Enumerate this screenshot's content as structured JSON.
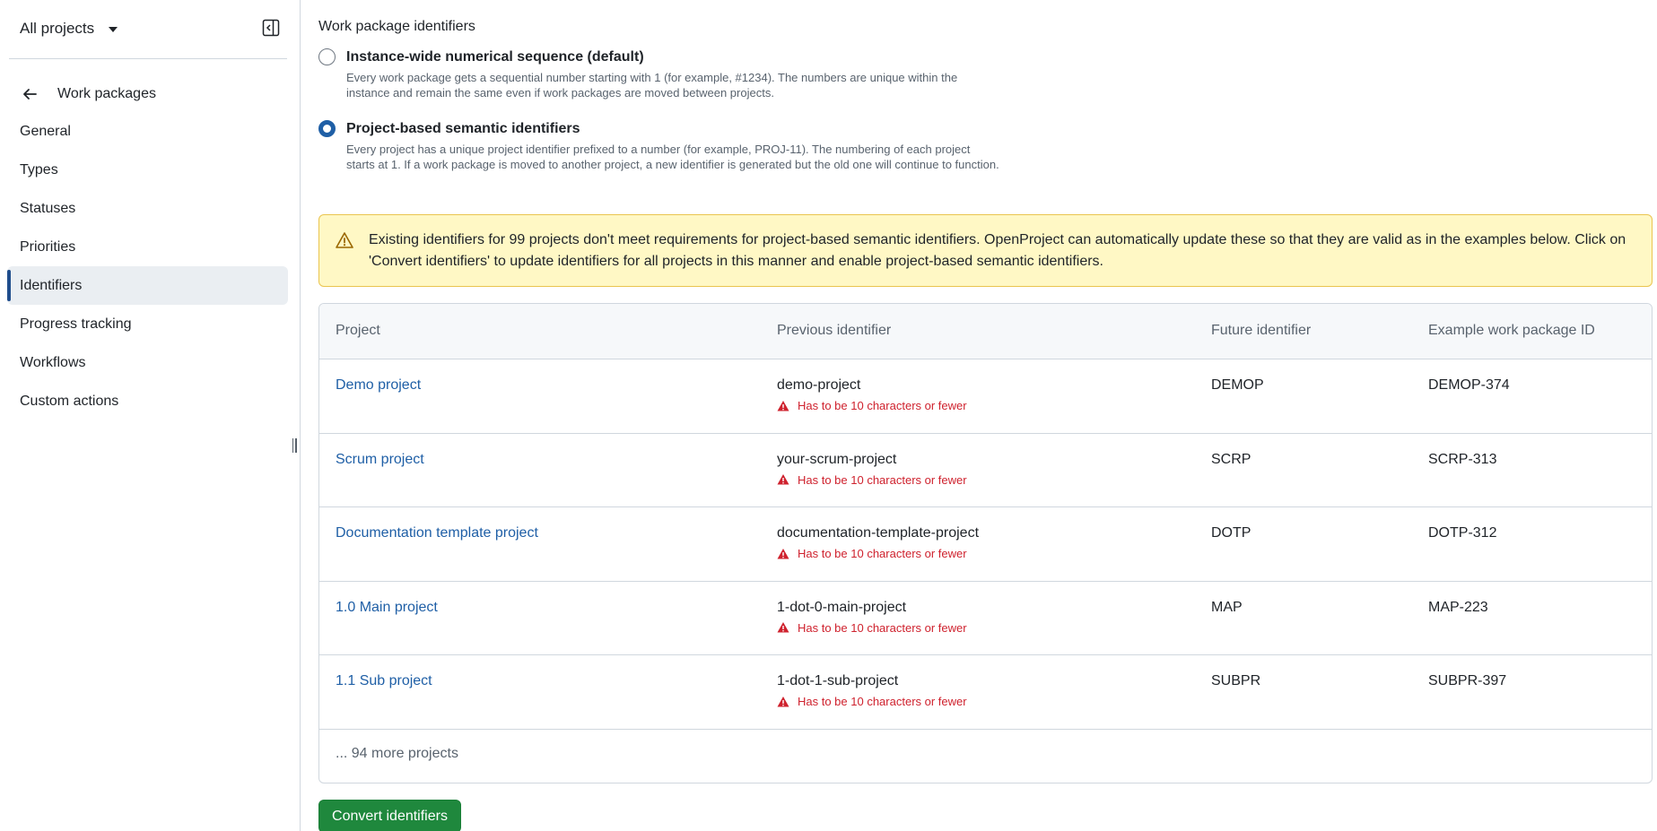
{
  "sidebar": {
    "project_selector": "All projects",
    "back_label": "Work packages",
    "items": [
      {
        "label": "General"
      },
      {
        "label": "Types"
      },
      {
        "label": "Statuses"
      },
      {
        "label": "Priorities"
      },
      {
        "label": "Identifiers",
        "active": true
      },
      {
        "label": "Progress tracking"
      },
      {
        "label": "Workflows"
      },
      {
        "label": "Custom actions"
      }
    ]
  },
  "main": {
    "section_title": "Work package identifiers",
    "options": [
      {
        "label": "Instance-wide numerical sequence (default)",
        "caption": "Every work package gets a sequential number starting with 1 (for example, #1234). The numbers are unique within the instance and remain the same even if work packages are moved between projects.",
        "checked": false
      },
      {
        "label": "Project-based semantic identifiers",
        "caption": "Every project has a unique project identifier prefixed to a number (for example, PROJ-11). The numbering of each project starts at 1. If a work package is moved to another project, a new identifier is generated but the old one will continue to function.",
        "checked": true
      }
    ],
    "warning": "Existing identifiers for 99 projects don't meet requirements for project-based semantic identifiers. OpenProject can automatically update these so that they are valid as in the examples below. Click on 'Convert identifiers' to update identifiers for all projects in this manner and enable project-based semantic identifiers.",
    "table": {
      "headers": [
        "Project",
        "Previous identifier",
        "Future identifier",
        "Example work package ID"
      ],
      "error_text": "Has to be 10 characters or fewer",
      "rows": [
        {
          "project": "Demo project",
          "previous": "demo-project",
          "future": "DEMOP",
          "example": "DEMOP-374"
        },
        {
          "project": "Scrum project",
          "previous": "your-scrum-project",
          "future": "SCRP",
          "example": "SCRP-313"
        },
        {
          "project": "Documentation template project",
          "previous": "documentation-template-project",
          "future": "DOTP",
          "example": "DOTP-312"
        },
        {
          "project": "1.0 Main project",
          "previous": "1-dot-0-main-project",
          "future": "MAP",
          "example": "MAP-223"
        },
        {
          "project": "1.1 Sub project",
          "previous": "1-dot-1-sub-project",
          "future": "SUBPR",
          "example": "SUBPR-397"
        }
      ],
      "more_text": "... 94 more projects"
    },
    "convert_button": "Convert identifiers"
  },
  "colors": {
    "accent": "#1f5fa6",
    "primary_button": "#1f883d",
    "warning_bg": "#fff8c5",
    "error": "#cf222e"
  }
}
